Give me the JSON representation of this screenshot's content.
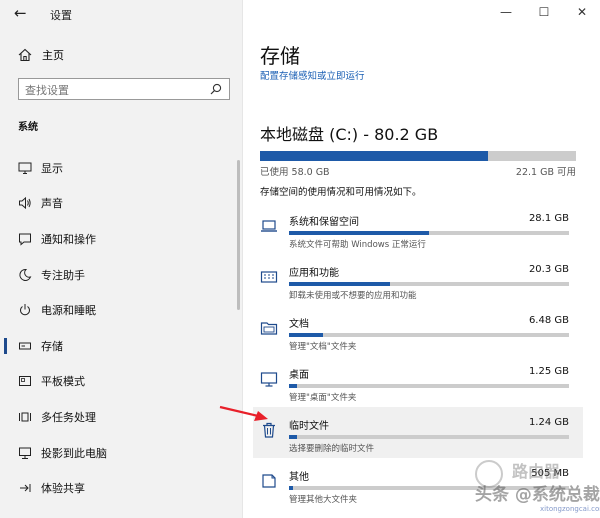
{
  "window": {
    "title": "设置",
    "back_glyph": "←",
    "minimize_glyph": "—",
    "maximize_glyph": "☐",
    "close_glyph": "✕"
  },
  "sidebar": {
    "home_label": "主页",
    "search_placeholder": "查找设置",
    "section_label": "系统",
    "items": [
      {
        "label": "显示",
        "icon": "display-icon"
      },
      {
        "label": "声音",
        "icon": "sound-icon"
      },
      {
        "label": "通知和操作",
        "icon": "notification-icon"
      },
      {
        "label": "专注助手",
        "icon": "moon-icon"
      },
      {
        "label": "电源和睡眠",
        "icon": "power-icon"
      },
      {
        "label": "存储",
        "icon": "storage-icon",
        "active": true
      },
      {
        "label": "平板模式",
        "icon": "tablet-icon"
      },
      {
        "label": "多任务处理",
        "icon": "multitask-icon"
      },
      {
        "label": "投影到此电脑",
        "icon": "project-icon"
      },
      {
        "label": "体验共享",
        "icon": "share-icon"
      }
    ]
  },
  "main": {
    "title": "存储",
    "config_link": "配置存储感知或立即运行",
    "drive": {
      "title": "本地磁盘 (C:) - 80.2 GB",
      "used_label": "已使用 58.0 GB",
      "available_label": "22.1 GB 可用",
      "used_fraction": 0.723
    },
    "usage_desc": "存储空间的使用情况和可用情况如下。",
    "categories": [
      {
        "name": "系统和保留空间",
        "size": "28.1 GB",
        "desc": "系统文件可帮助 Windows 正常运行",
        "fraction": 0.5,
        "icon": "laptop-icon"
      },
      {
        "name": "应用和功能",
        "size": "20.3 GB",
        "desc": "卸载未使用或不想要的应用和功能",
        "fraction": 0.36,
        "icon": "keyboard-icon"
      },
      {
        "name": "文档",
        "size": "6.48 GB",
        "desc": "管理\"文档\"文件夹",
        "fraction": 0.12,
        "icon": "folder-icon"
      },
      {
        "name": "桌面",
        "size": "1.25 GB",
        "desc": "管理\"桌面\"文件夹",
        "fraction": 0.03,
        "icon": "monitor-icon"
      },
      {
        "name": "临时文件",
        "size": "1.24 GB",
        "desc": "选择要删除的临时文件",
        "fraction": 0.03,
        "icon": "trash-icon",
        "highlight": true
      },
      {
        "name": "其他",
        "size": "505 MB",
        "desc": "管理其他大文件夹",
        "fraction": 0.01,
        "icon": "other-icon"
      }
    ]
  },
  "watermark": {
    "main": "头条 @系统总裁",
    "brand": "路由器",
    "url": "xitongzongcai.com"
  }
}
